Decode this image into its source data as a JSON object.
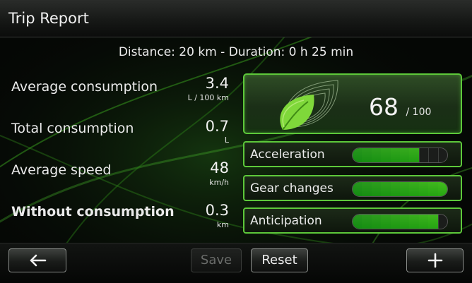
{
  "header": {
    "title": "Trip Report"
  },
  "summary": "Distance: 20 km - Duration: 0 h 25 min",
  "stats": [
    {
      "label": "Average consumption",
      "value": "3.4",
      "unit": "L / 100 km",
      "bold": false
    },
    {
      "label": "Total consumption",
      "value": "0.7",
      "unit": "L",
      "bold": false
    },
    {
      "label": "Average speed",
      "value": "48",
      "unit": "km/h",
      "bold": false
    },
    {
      "label": "Without consumption",
      "value": "0.3",
      "unit": "km",
      "bold": true
    }
  ],
  "score": {
    "value": "68",
    "max": "/ 100",
    "icon": "eco-leaf-icon"
  },
  "criteria": [
    {
      "label": "Acceleration",
      "level_percent": 74
    },
    {
      "label": "Gear changes",
      "level_percent": 100
    },
    {
      "label": "Anticipation",
      "level_percent": 88
    }
  ],
  "footer": {
    "back_icon": "arrow-left-icon",
    "save_label": "Save",
    "save_enabled": false,
    "reset_label": "Reset",
    "add_icon": "plus-icon"
  },
  "colors": {
    "accent": "#5dc83a",
    "bar_fill": "#3fae2a",
    "background": "#050705"
  }
}
